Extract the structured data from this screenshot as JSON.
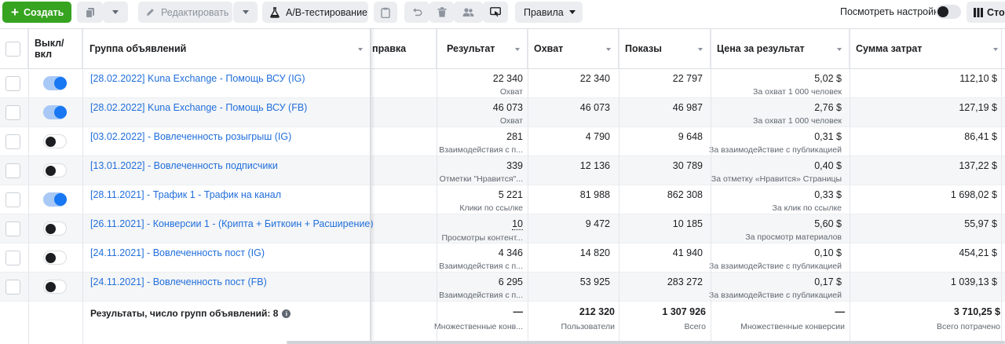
{
  "toolbar": {
    "create_label": "Создать",
    "edit_label": "Редактировать",
    "ab_label": "A/B-тестирование",
    "rules_label": "Правила",
    "settings_label": "Посмотреть настройки",
    "columns_label": "Сто"
  },
  "columns": {
    "onoff": "Выкл/\nвкл",
    "group": "Группа объявлений",
    "edit": "яя правка",
    "result": "Результат",
    "reach": "Охват",
    "impressions": "Показы",
    "cost": "Цена за результат",
    "spent": "Сумма затрат"
  },
  "rows": [
    {
      "on": true,
      "name": "[28.02.2022] Kuna Exchange - Помощь ВСУ (IG)",
      "result": "22 340",
      "result_sub": "Охват",
      "reach": "22 340",
      "impressions": "22 797",
      "cost": "5,02 $",
      "cost_sub": "За охват 1 000 человек",
      "spent": "112,10 $"
    },
    {
      "on": true,
      "name": "[28.02.2022] Kuna Exchange - Помощь ВСУ (FB)",
      "result": "46 073",
      "result_sub": "Охват",
      "reach": "46 073",
      "impressions": "46 987",
      "cost": "2,76 $",
      "cost_sub": "За охват 1 000 человек",
      "spent": "127,19 $"
    },
    {
      "on": false,
      "name": "[03.02.2022] - Вовлеченность розыгрыш (IG)",
      "result": "281",
      "result_sub": "Взаимодействия с п...",
      "reach": "4 790",
      "impressions": "9 648",
      "cost": "0,31 $",
      "cost_sub": "За взаимодействие с публикацией",
      "spent": "86,41 $"
    },
    {
      "on": false,
      "name": "[13.01.2022] - Вовлеченность подписчики",
      "result": "339",
      "result_sub": "Отметки \"Нравится\"...",
      "reach": "12 136",
      "impressions": "30 789",
      "cost": "0,40 $",
      "cost_sub": "За отметку «Нравится» Страницы",
      "spent": "137,22 $"
    },
    {
      "on": true,
      "name": "[28.11.2021] - Трафик 1 - Трафик на канал",
      "result": "5 221",
      "result_sub": "Клики по ссылке",
      "reach": "81 988",
      "impressions": "862 308",
      "cost": "0,33 $",
      "cost_sub": "За клик по ссылке",
      "spent": "1 698,02 $"
    },
    {
      "on": false,
      "name": "[26.11.2021] - Конверсии 1 - (Крипта + Биткоин + Расширение)",
      "result": "10",
      "result_sub": "Просмотры контент...",
      "reach": "9 472",
      "impressions": "10 185",
      "cost": "5,60 $",
      "cost_sub": "За просмотр материалов",
      "spent": "55,97 $"
    },
    {
      "on": false,
      "name": "[24.11.2021] - Вовлеченность пост (IG)",
      "result": "4 346",
      "result_sub": "Взаимодействия с п...",
      "reach": "14 820",
      "impressions": "41 940",
      "cost": "0,10 $",
      "cost_sub": "За взаимодействие с публикацией",
      "spent": "454,21 $"
    },
    {
      "on": false,
      "name": "[24.11.2021] - Вовлеченность пост (FB)",
      "result": "6 295",
      "result_sub": "Взаимодействия с п...",
      "reach": "53 925",
      "impressions": "283 272",
      "cost": "0,17 $",
      "cost_sub": "За взаимодействие с публикацией",
      "spent": "1 039,13 $"
    }
  ],
  "footer": {
    "label": "Результаты, число групп объявлений: 8",
    "result": "—",
    "result_sub": "Множественные конв...",
    "reach": "212 320",
    "reach_sub": "Пользователи",
    "impressions": "1 307 926",
    "impressions_sub": "Всего",
    "cost": "—",
    "cost_sub": "Множественные конверсии",
    "spent": "3 710,25 $",
    "spent_sub": "Всего потрачено"
  }
}
